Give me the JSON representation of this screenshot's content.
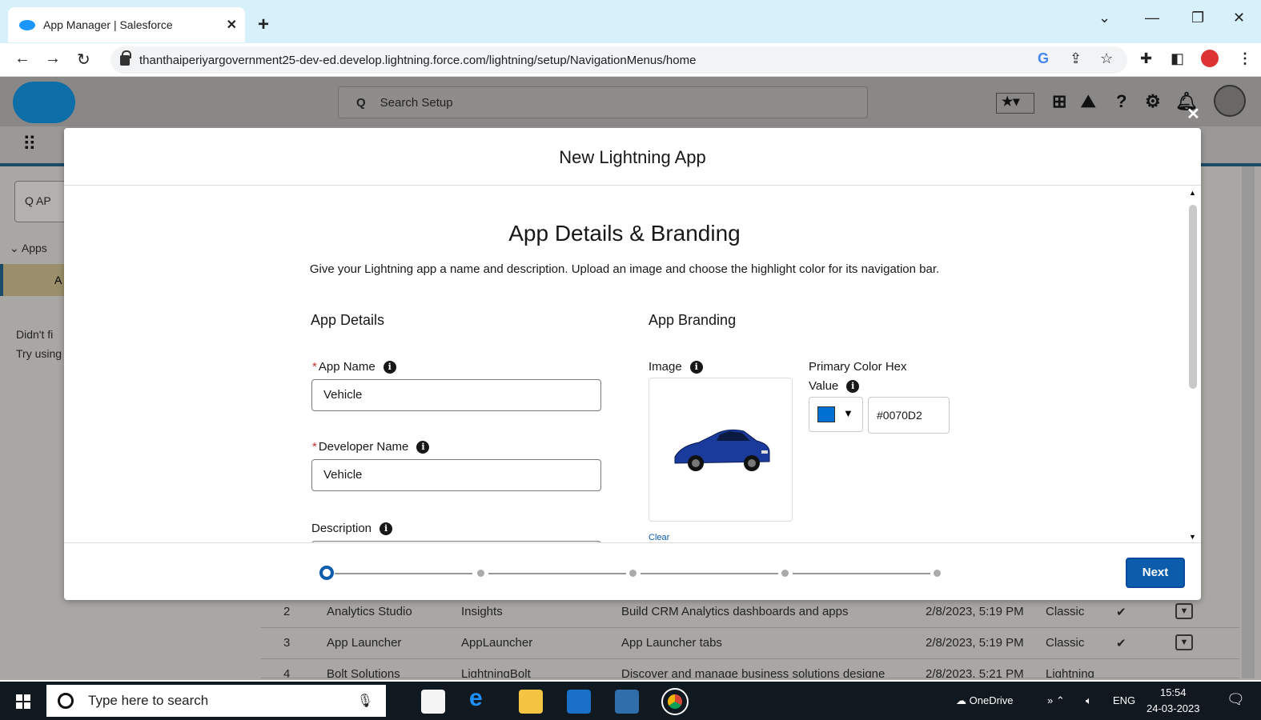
{
  "browser": {
    "tab_title": "App Manager | Salesforce",
    "url": "thanthaiperiyargovernment25-dev-ed.develop.lightning.force.com/lightning/setup/NavigationMenus/home"
  },
  "sf": {
    "search_placeholder": "Search Setup",
    "quickfind_value": "AP",
    "tree_apps": "Apps",
    "tree_selected": "A",
    "didnt_find": "Didn't fi",
    "try_using": "Try using"
  },
  "table": {
    "rows": [
      {
        "num": "2",
        "name": "Analytics Studio",
        "dev": "Insights",
        "desc": "Build CRM Analytics dashboards and apps",
        "date": "2/8/2023, 5:19 PM",
        "type": "Classic"
      },
      {
        "num": "3",
        "name": "App Launcher",
        "dev": "AppLauncher",
        "desc": "App Launcher tabs",
        "date": "2/8/2023, 5:19 PM",
        "type": "Classic"
      },
      {
        "num": "4",
        "name": "Bolt Solutions",
        "dev": "LightningBolt",
        "desc": "Discover and manage business solutions designe",
        "date": "2/8/2023, 5:21 PM",
        "type": "Lightning"
      }
    ]
  },
  "modal": {
    "title": "New Lightning App",
    "section_title": "App Details & Branding",
    "section_desc": "Give your Lightning app a name and description. Upload an image and choose the highlight color for its navigation bar.",
    "app_details_heading": "App Details",
    "app_branding_heading": "App Branding",
    "app_name_label": "App Name",
    "app_name_value": "Vehicle",
    "developer_name_label": "Developer Name",
    "developer_name_value": "Vehicle",
    "description_label": "Description",
    "image_label": "Image",
    "clear_link": "Clear",
    "primary_color_label_1": "Primary Color Hex",
    "primary_color_label_2": "Value",
    "primary_color_value": "#0070D2",
    "next_button": "Next",
    "progress_steps": 5,
    "progress_current": 1
  },
  "taskbar": {
    "search_placeholder": "Type here to search",
    "onedrive": "OneDrive",
    "lang": "ENG",
    "time": "15:54",
    "date": "24-03-2023"
  },
  "colors": {
    "brand_blue": "#0b5cab",
    "primary_color": "#0070d2"
  }
}
